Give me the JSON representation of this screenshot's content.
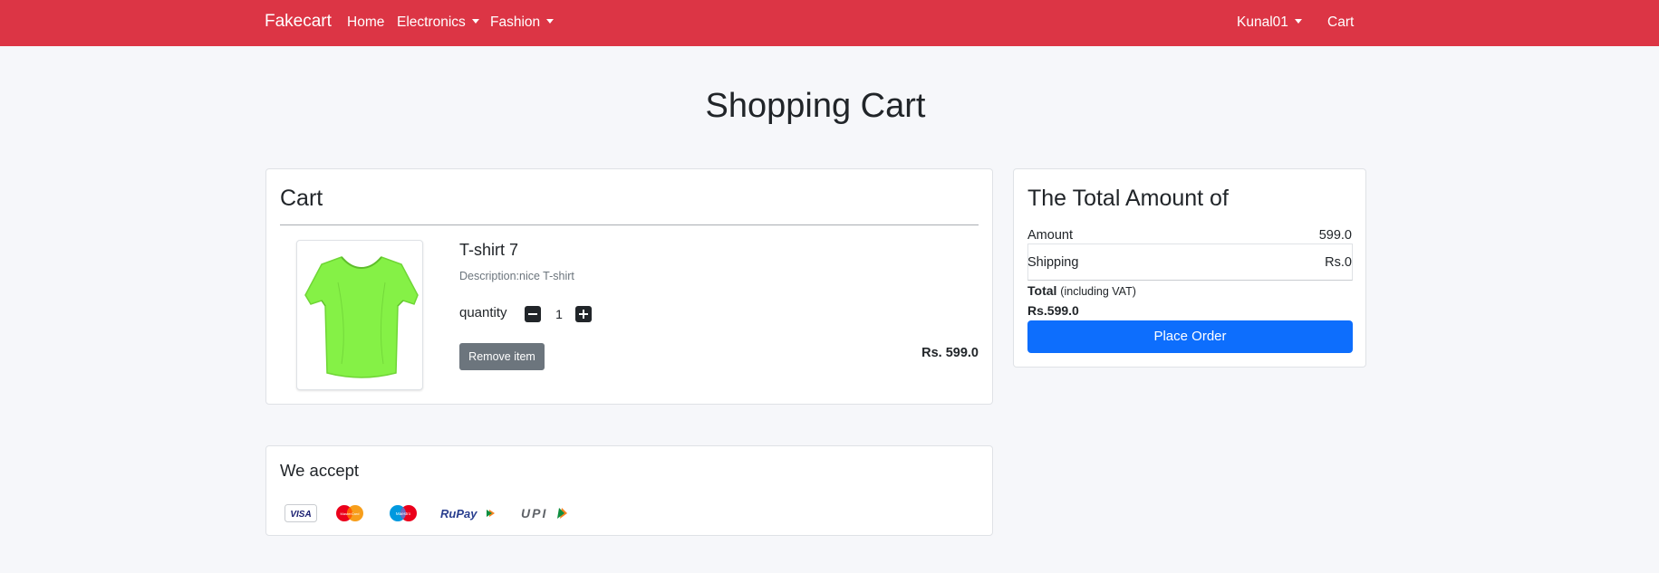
{
  "navbar": {
    "brand": "Fakecart",
    "links": [
      {
        "label": "Home",
        "dropdown": false
      },
      {
        "label": "Electronics",
        "dropdown": true
      },
      {
        "label": "Fashion",
        "dropdown": true
      }
    ],
    "user": "Kunal01",
    "cart": "Cart",
    "bg_color": "#dc3545"
  },
  "page_title": "Shopping Cart",
  "cart": {
    "heading": "Cart",
    "item": {
      "name": "T-shirt 7",
      "description": "Description:nice T-shirt",
      "quantity_label": "quantity",
      "quantity": "1",
      "remove_label": "Remove item",
      "price": "Rs. 599.0",
      "image_icon": "tshirt-image",
      "image_color": "#85f146"
    }
  },
  "summary": {
    "heading": "The Total Amount of",
    "amount_label": "Amount",
    "amount_value": "599.0",
    "shipping_label": "Shipping",
    "shipping_value": "Rs.0",
    "total_label": "Total",
    "total_note": "(including VAT)",
    "total_value": "Rs.599.0",
    "button_label": "Place Order",
    "button_color": "#0d6efd"
  },
  "payments": {
    "heading": "We accept",
    "methods": [
      "VISA",
      "MasterCard",
      "Maestro",
      "RuPay",
      "UPI"
    ]
  }
}
